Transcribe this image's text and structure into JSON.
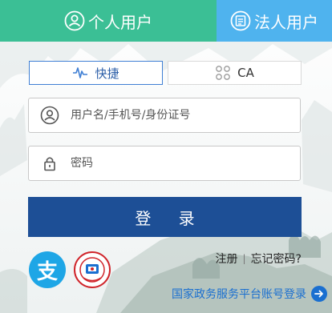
{
  "tabs": [
    {
      "label": "个人用户",
      "icon": "user-circle-icon",
      "color": "#3bbf95",
      "active": true
    },
    {
      "label": "法人用户",
      "icon": "id-card-icon",
      "color": "#4fb3ee",
      "active": false
    }
  ],
  "login_modes": [
    {
      "label": "快捷",
      "icon": "pulse-icon",
      "selected": true
    },
    {
      "label": "CA",
      "icon": "ca-cert-icon",
      "selected": false
    }
  ],
  "username": {
    "placeholder": "用户名/手机号/身份证号",
    "value": ""
  },
  "password": {
    "placeholder": "密码",
    "value": ""
  },
  "login_button": {
    "label": "登 录",
    "color": "#1d4f96"
  },
  "third_party": [
    {
      "name": "alipay",
      "icon": "alipay-icon",
      "glyph": "支",
      "color": "#1ea6e6"
    },
    {
      "name": "social-security-card",
      "icon": "social-security-card-icon"
    }
  ],
  "links": {
    "register": "注册",
    "separator": "|",
    "forgot_password": "忘记密码?"
  },
  "national_login": {
    "label": "国家政务服务平台账号登录"
  },
  "colors": {
    "accent": "#1a6fd0",
    "border": "#c8c8c8"
  }
}
